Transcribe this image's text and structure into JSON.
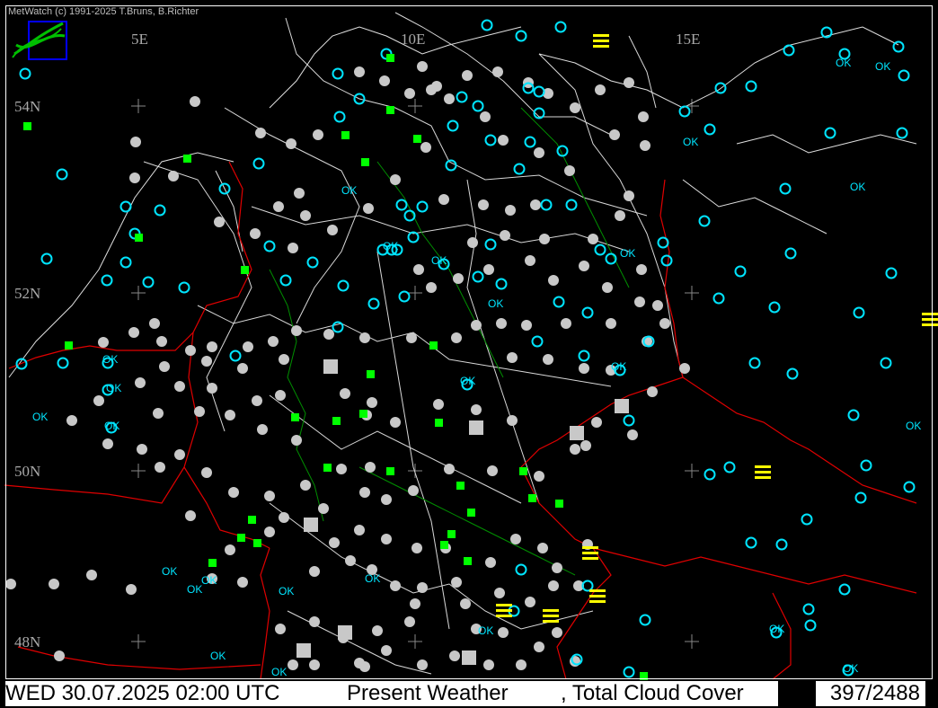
{
  "header": {
    "copyright": "MetWatch  (c) 1991-2025 T.Bruns, B.Richter"
  },
  "grid_labels": {
    "lon": [
      "5E",
      "10E",
      "15E"
    ],
    "lat": [
      "54N",
      "52N",
      "50N",
      "48N"
    ]
  },
  "status_bar": {
    "datetime": "WED 30.07.2025 02:00 UTC",
    "product": "Present Weather",
    "overlay": ", Total Cloud Cover",
    "count": "397/2488"
  },
  "colors": {
    "background": "#000000",
    "coastline_borders": "#ffffff",
    "national_border": "#ff0000",
    "rivers": "#00a000",
    "cloud_clear": "#00e5ff",
    "cloud_overcast": "#c8c8c8",
    "weather_rain": "#00ff00",
    "weather_fog": "#ffff00"
  },
  "legend_text": {
    "ok_marker": "OK"
  }
}
